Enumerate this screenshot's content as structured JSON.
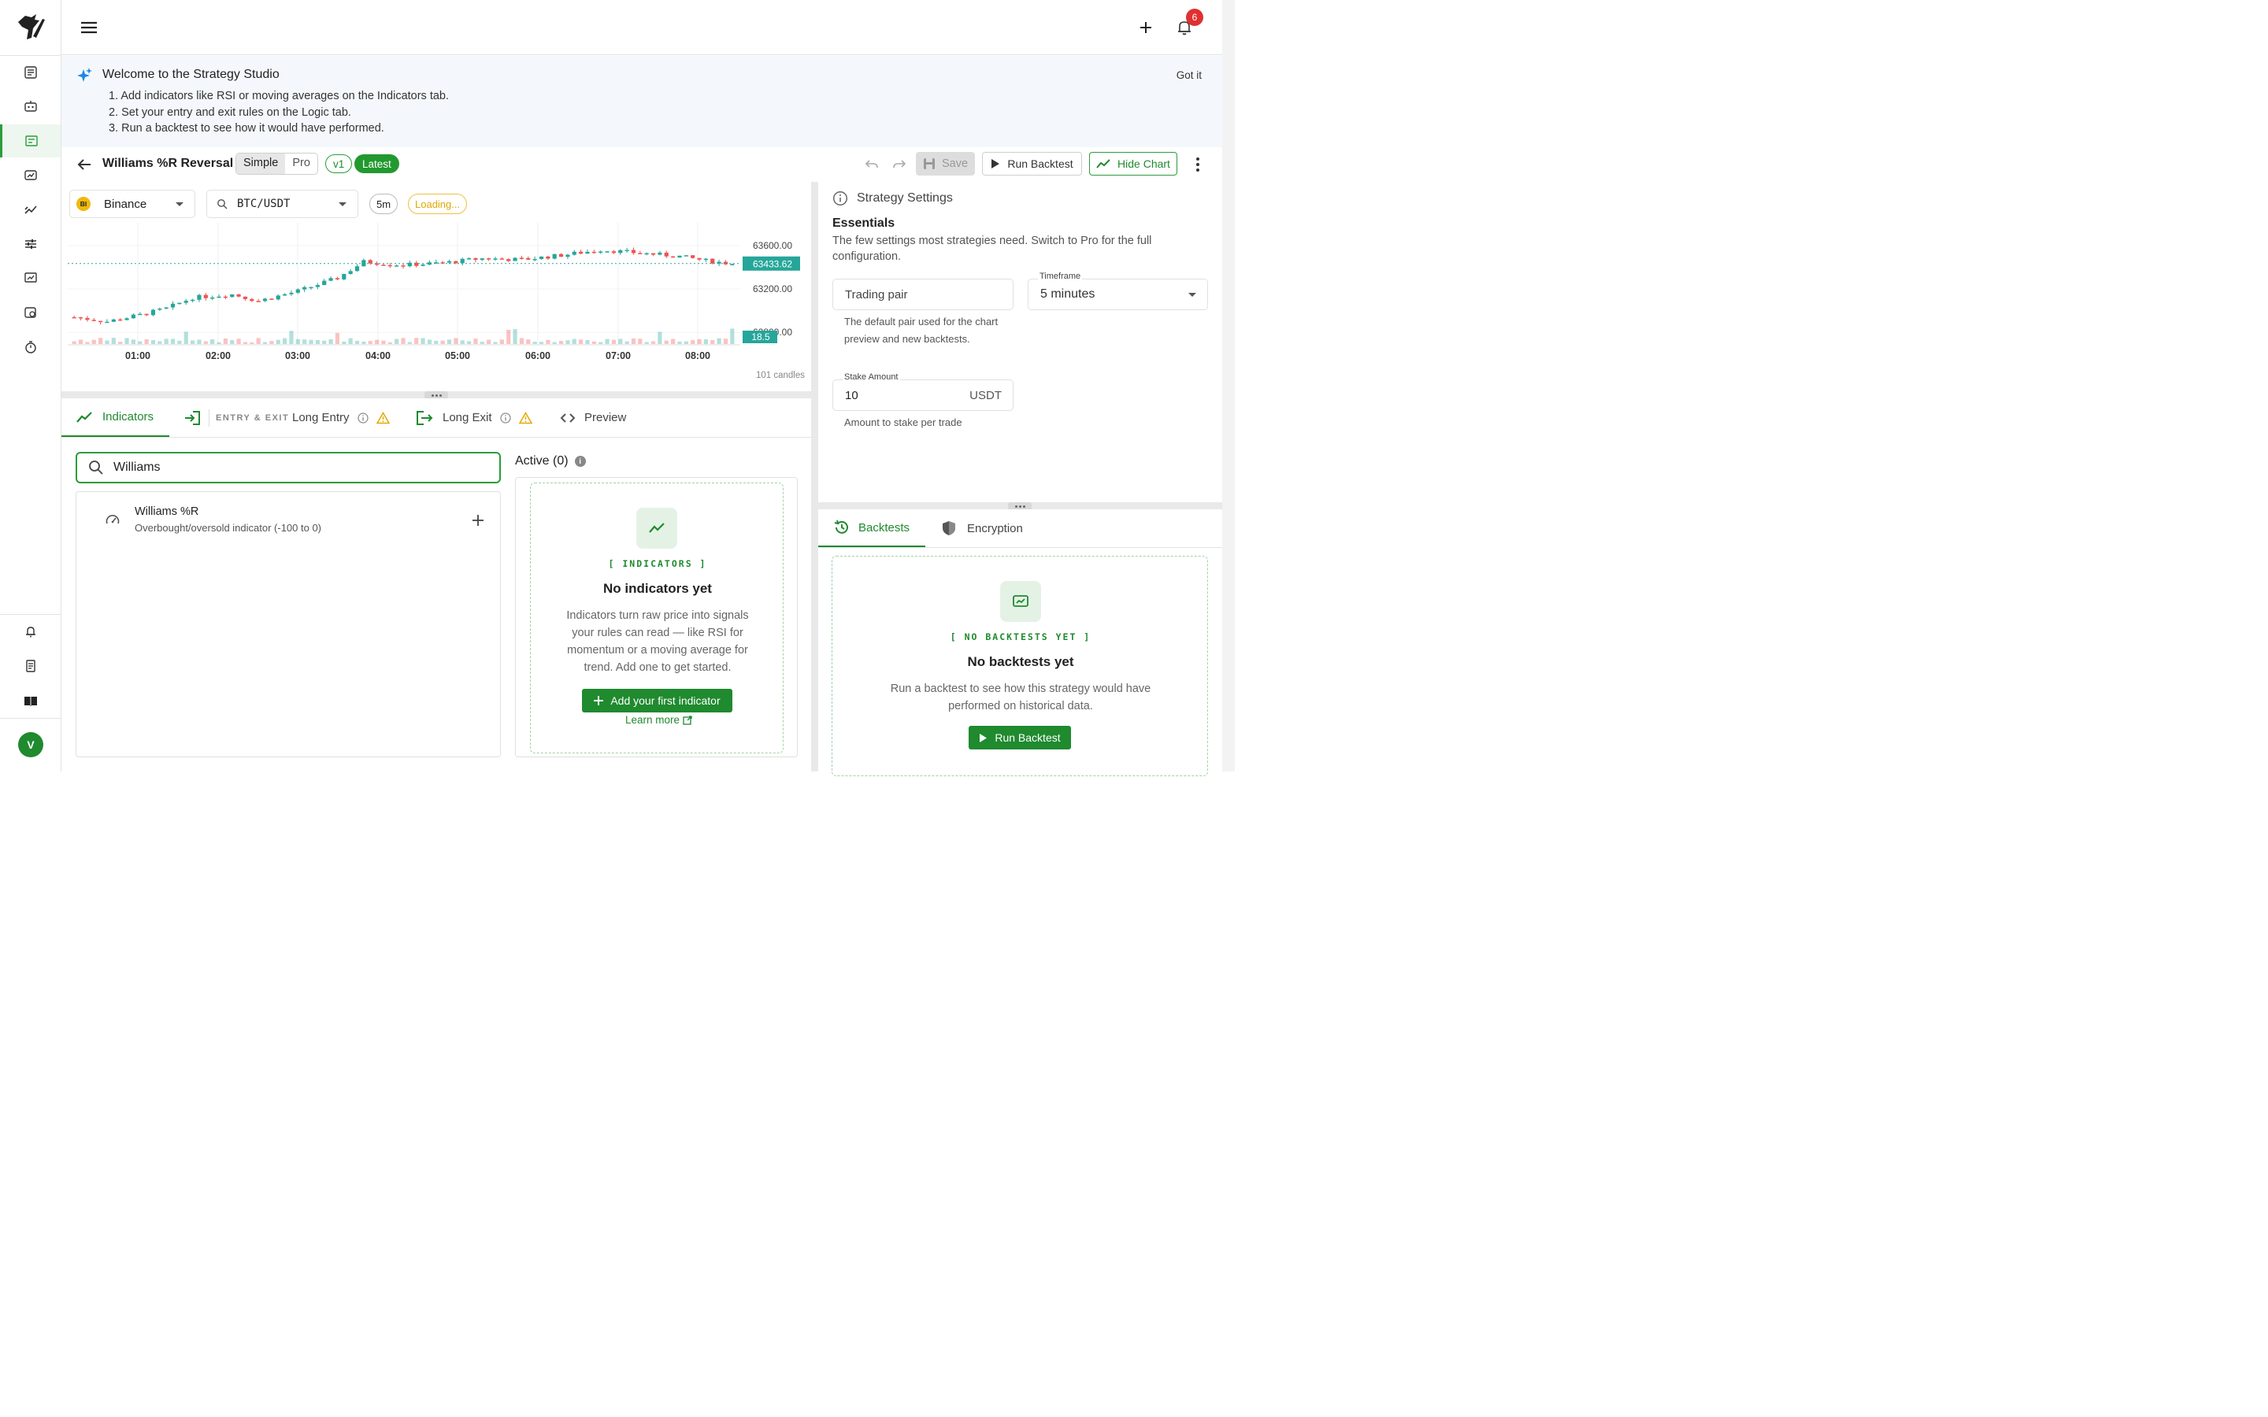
{
  "app": {
    "notification_count": "6",
    "avatar_initial": "V"
  },
  "welcome": {
    "title": "Welcome to the Strategy Studio",
    "steps": [
      "1. Add indicators like RSI or moving averages on the Indicators tab.",
      "2. Set your entry and exit rules on the Logic tab.",
      "3. Run a backtest to see how it would have performed."
    ],
    "dismiss_label": "Got it"
  },
  "header": {
    "strategy_name": "Williams %R Reversal",
    "mode_simple": "Simple",
    "mode_pro": "Pro",
    "active_mode": "Simple",
    "version": "v1",
    "latest_label": "Latest",
    "save_label": "Save",
    "run_backtest_label": "Run Backtest",
    "hide_chart_label": "Hide Chart"
  },
  "chart_toolbar": {
    "exchange_logo": "BI",
    "exchange": "Binance",
    "pair": "BTC/USDT",
    "timeframe": "5m",
    "status": "Loading..."
  },
  "chart_data": {
    "type": "candlestick",
    "x_ticks": [
      "01:00",
      "02:00",
      "03:00",
      "04:00",
      "05:00",
      "06:00",
      "07:00",
      "08:00"
    ],
    "y_ticks": [
      "63600.00",
      "63200.00",
      "62800.00"
    ],
    "last_price": "63433.62",
    "last_volume": "18.5",
    "candle_count_label": "101 candles",
    "ylim": [
      62700,
      63780
    ]
  },
  "tabs": {
    "indicators": "Indicators",
    "entry_exit_group": "ENTRY & EXIT",
    "long_entry": "Long Entry",
    "long_exit": "Long Exit",
    "preview": "Preview"
  },
  "indicator_search": {
    "value": "Williams",
    "results": [
      {
        "name": "Williams %R",
        "description": "Overbought/oversold indicator (-100 to 0)"
      }
    ]
  },
  "active_indicators": {
    "title": "Active (0)",
    "empty_tag": "[ INDICATORS ]",
    "empty_title": "No indicators yet",
    "empty_desc": "Indicators turn raw price into signals your rules can read — like RSI for momentum or a moving average for trend. Add one to get started.",
    "add_button": "Add your first indicator",
    "learn_more": "Learn more"
  },
  "settings": {
    "title": "Strategy Settings",
    "section": "Essentials",
    "section_desc": "The few settings most strategies need. Switch to Pro for the full configuration.",
    "trading_pair_placeholder": "Trading pair",
    "trading_pair_help": "The default pair used for the chart preview and new backtests.",
    "timeframe_label": "Timeframe",
    "timeframe_value": "5 minutes",
    "stake_label": "Stake Amount",
    "stake_value": "10",
    "stake_unit": "USDT",
    "stake_help": "Amount to stake per trade"
  },
  "bottom_tabs": {
    "backtests": "Backtests",
    "encryption": "Encryption"
  },
  "backtests_empty": {
    "tag": "[ NO BACKTESTS YET ]",
    "title": "No backtests yet",
    "desc": "Run a backtest to see how this strategy would have performed on historical data.",
    "button": "Run Backtest"
  },
  "colors": {
    "accent": "#1f8a2e",
    "up": "#26a69a",
    "down": "#ef5350",
    "badge": "#e03131"
  }
}
